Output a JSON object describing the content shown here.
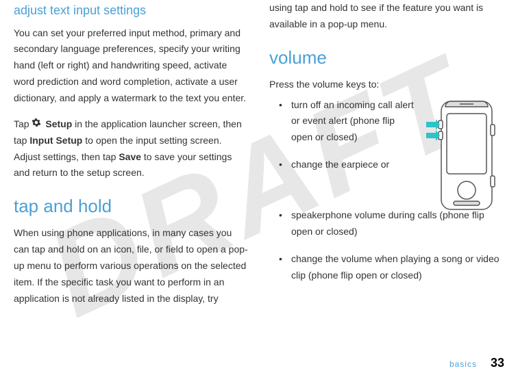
{
  "watermark": "DRAFT",
  "left_column": {
    "h_adjust": "adjust text input settings",
    "p1": "You can set your preferred input method, primary and secondary language preferences, specify your writing hand (left or right) and handwriting speed, activate word prediction and word completion, activate a user dictionary, and apply a watermark to the text you enter.",
    "p2_pre": "Tap ",
    "setup_label": "Setup",
    "p2_mid": " in the application launcher screen, then tap ",
    "input_setup_label": "Input Setup",
    "p2_mid2": " to open the input setting screen. Adjust settings, then tap ",
    "save_label": "Save",
    "p2_post": " to save your settings and return to the setup screen.",
    "h_tap": "tap and hold",
    "p3": "When using phone applications, in many cases you can tap and hold on an icon, file, or field to open a pop-up menu to perform various operations on the selected item. If the specific task you want to perform in an application is not already listed in the display, try"
  },
  "right_column": {
    "p_cont": "using tap and hold to see if the feature you want is available in a pop-up menu.",
    "h_volume": "volume",
    "p_intro": "Press the volume keys to:",
    "b1": "turn off an incoming call alert or event alert (phone flip open or closed)",
    "b2": "change the earpiece or speakerphone volume during calls (phone flip open or closed)",
    "b3": "change the volume when playing a song or video clip (phone flip open or closed)"
  },
  "footer": {
    "label": "basics",
    "page": "33"
  }
}
